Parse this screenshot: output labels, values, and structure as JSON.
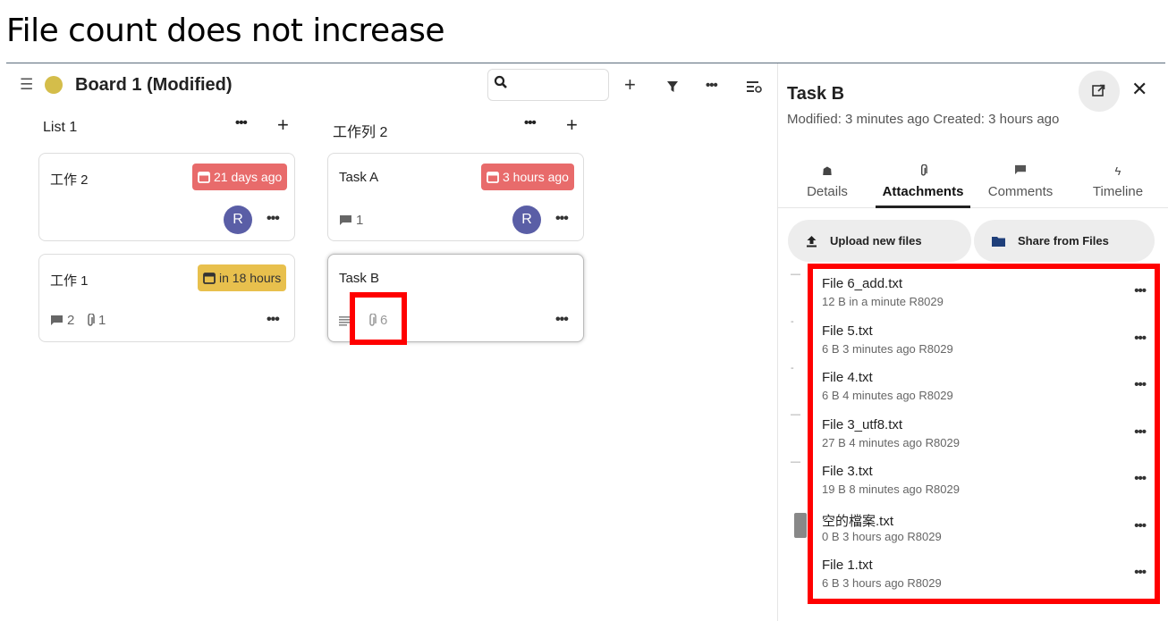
{
  "slide_title": "File count does not increase",
  "board": {
    "menu_icon": "hamburger-icon",
    "name": "Board 1 (Modified)",
    "color": "#d4bd4a",
    "toolbar": {
      "search_icon": "search-icon",
      "add_icon": "plus-icon",
      "filter_icon": "filter-icon",
      "more_icon": "more-icon",
      "details_icon": "board-details-icon"
    },
    "lists": [
      {
        "title": "List 1",
        "cards": [
          {
            "title": "工作 2",
            "due": "21 days ago",
            "due_color": "#e86b6b",
            "avatar": "R"
          },
          {
            "title": "工作 1",
            "due": "in 18 hours",
            "due_color": "#e8c04d",
            "comments": "2",
            "attachments": "1"
          }
        ]
      },
      {
        "title": "工作列 2",
        "cards": [
          {
            "title": "Task A",
            "due": "3 hours ago",
            "due_color": "#e86b6b",
            "comments": "1",
            "avatar": "R"
          },
          {
            "title": "Task B",
            "attachments": "6"
          }
        ]
      }
    ]
  },
  "sidebar": {
    "title": "Task B",
    "meta": "Modified: 3 minutes ago Created: 3 hours ago",
    "tabs": [
      {
        "label": "Details",
        "icon": "home-icon"
      },
      {
        "label": "Attachments",
        "icon": "paperclip-icon",
        "active": true
      },
      {
        "label": "Comments",
        "icon": "comment-icon"
      },
      {
        "label": "Timeline",
        "icon": "lightning-icon"
      }
    ],
    "upload_label": "Upload new files",
    "share_label": "Share from Files",
    "files": [
      {
        "name": "File 6_add.txt",
        "meta": "12 B in a minute R8029"
      },
      {
        "name": "File 5.txt",
        "meta": "6 B 3 minutes ago R8029"
      },
      {
        "name": "File 4.txt",
        "meta": "6 B 4 minutes ago R8029"
      },
      {
        "name": "File 3_utf8.txt",
        "meta": "27 B 4 minutes ago R8029"
      },
      {
        "name": "File 3.txt",
        "meta": "19 B 8 minutes ago R8029"
      },
      {
        "name": "空的檔案.txt",
        "meta": "0 B 3 hours ago R8029"
      },
      {
        "name": "File 1.txt",
        "meta": "6 B 3 hours ago R8029"
      }
    ],
    "highlight_color": "#ff0000"
  }
}
